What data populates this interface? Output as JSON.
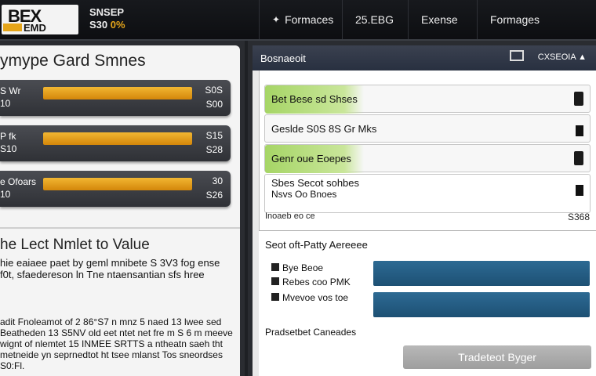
{
  "header": {
    "logo_top": "BEX",
    "logo_bottom": "EMD",
    "ticker_line1": "SNSEP",
    "ticker_line2": "S30",
    "ticker_pct": "0%",
    "nav": [
      {
        "label": "Formaces",
        "icon": "gear-icon"
      },
      {
        "label": "25.EBG",
        "icon": ""
      },
      {
        "label": "Exense",
        "icon": ""
      },
      {
        "label": "Formages",
        "icon": ""
      }
    ]
  },
  "left": {
    "title": "ymype Gard Smnes",
    "bars": [
      {
        "label1": "S Wr",
        "label2": "10",
        "value1": "S0S",
        "value2": "S00",
        "level": 1.0
      },
      {
        "label1": "P fk",
        "label2": "S10",
        "value1": "S15",
        "value2": "S28",
        "level": 1.0
      },
      {
        "label1": "e Ofoars",
        "label2": "10",
        "value1": "30",
        "value2": "S26",
        "level": 1.0
      }
    ],
    "lower_title": "he Lect Nmlet to Value",
    "lower_text1": "hie eaiaee paet by geml mnibete S 3V3 fog ense f0t, sfaedereson ln Tne ntaensantian sfs hree",
    "lower_text2": "adit Fnoleamot of 2 86°S7 n mnz 5 naed 13 lwee sed Beatheden 13 S5NV old eet ntet net fre m S 6 m meeve wignt of nlemtet 15 INMEE SRTTS a ntheatn saeh tht metneide yn seprnedtot ht tsee mlanst Tos sneordses S0:Fl."
  },
  "right": {
    "header_title": "Bosnaeoit",
    "header_right": "CXSEOIA",
    "items": [
      {
        "text": "Bet Bese sd Shses",
        "green": true
      },
      {
        "text": "Geslde S0S 8S Gr Mks",
        "green": false
      },
      {
        "text": "Genr oue Eoepes",
        "green": true
      }
    ],
    "multi_item": {
      "line1": "Sbes Secot sohbes",
      "line2": "Nsvs Oo Bnoes"
    },
    "summary_label": "Inoaeb eo ce",
    "summary_value": "S368",
    "lower_title": "Seot oft-Patty Aereeee",
    "options": [
      "Bye Beoe",
      "Rebes coo PMK",
      "Mvevoe vos toe"
    ],
    "footer_label": "Pradsetbet Caneades",
    "action_button": "Tradeteot Byger"
  }
}
